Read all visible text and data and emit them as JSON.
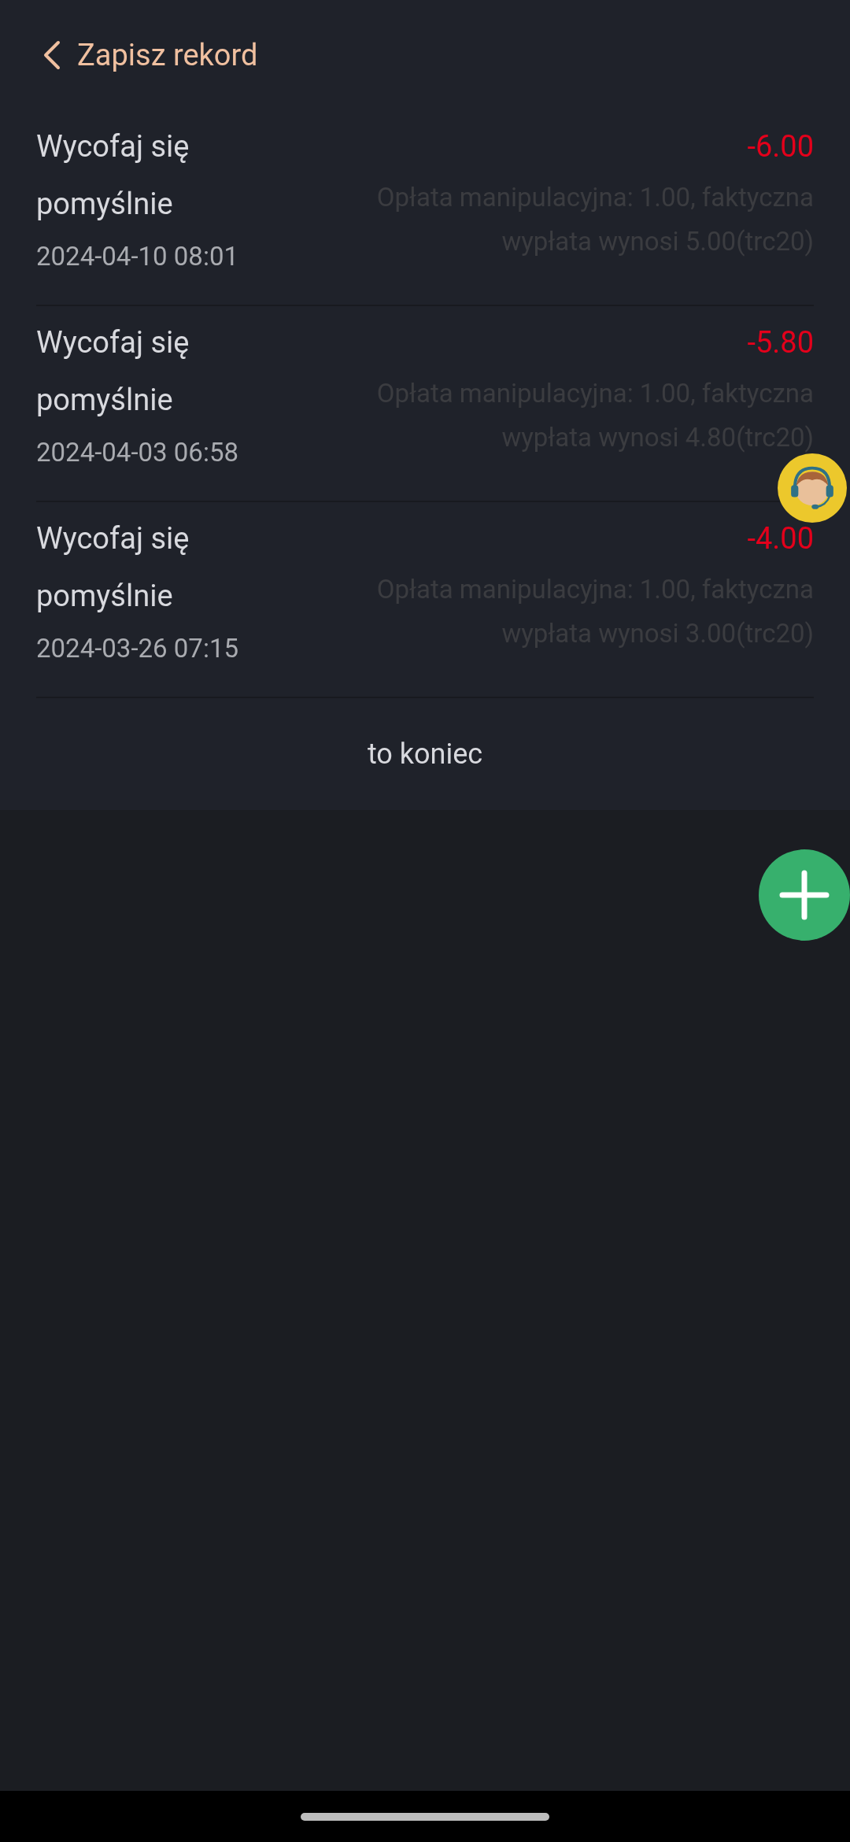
{
  "header": {
    "title": "Zapisz rekord"
  },
  "records": [
    {
      "title": "Wycofaj się pomyślnie",
      "date": "2024-04-10 08:01",
      "amount": "-6.00",
      "note": "Opłata manipulacyjna: 1.00, faktyczna wypłata wynosi 5.00(trc20)"
    },
    {
      "title": "Wycofaj się pomyślnie",
      "date": "2024-04-03 06:58",
      "amount": "-5.80",
      "note": "Opłata manipulacyjna: 1.00, faktyczna wypłata wynosi 4.80(trc20)"
    },
    {
      "title": "Wycofaj się pomyślnie",
      "date": "2024-03-26 07:15",
      "amount": "-4.00",
      "note": "Opłata manipulacyjna: 1.00, faktyczna wypłata wynosi 3.00(trc20)"
    }
  ],
  "end_text": "to koniec"
}
